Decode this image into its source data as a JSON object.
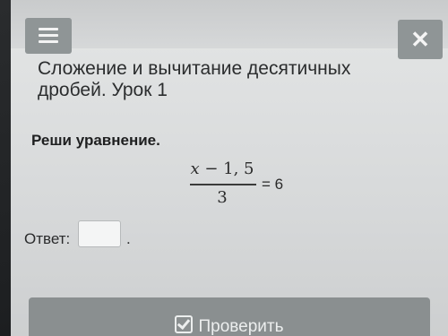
{
  "header": {
    "menu_icon": "hamburger-menu-icon",
    "close_label": "✕"
  },
  "lesson": {
    "title": "Сложение и вычитание десятичных дробей. Урок 1"
  },
  "task": {
    "instruction": "Реши уравнение.",
    "equation": {
      "numerator_var": "x",
      "numerator_rest": " − 1, 5",
      "denominator": "3",
      "rhs": "= 6"
    }
  },
  "answer": {
    "label": "Ответ:",
    "value": "",
    "suffix": "."
  },
  "actions": {
    "check_label": "Проверить",
    "check_icon": "checkbox-check-icon"
  }
}
